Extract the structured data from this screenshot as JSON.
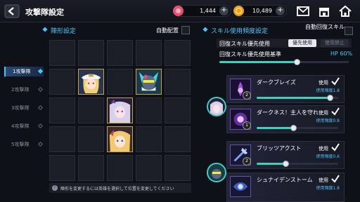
{
  "header": {
    "title": "攻撃隊設定",
    "currency1": "1,444",
    "currency2": "10,489",
    "plus": "+"
  },
  "left": {
    "section_title": "陣形設定",
    "auto_place": "自動配置",
    "tabs": [
      {
        "label": "1攻撃隊",
        "active": true
      },
      {
        "label": "2攻撃隊",
        "active": false
      },
      {
        "label": "3攻撃隊",
        "active": false
      },
      {
        "label": "4攻撃隊",
        "active": false
      },
      {
        "label": "5攻撃隊",
        "active": false
      }
    ],
    "hint_icon": "!",
    "hint": "陣形を変更するには英雄を選択して位置を変更してください"
  },
  "right": {
    "section_title": "スキル使用頻度設定",
    "auto_recovery": "自動回復スキル",
    "priority_label": "回復スキル優先使用",
    "priority_on": "優先使用",
    "priority_off": "使用禁止",
    "threshold_label": "回復スキル優先使用基準",
    "threshold_value": "HP 60%",
    "threshold_level": 0.6,
    "skills": [
      {
        "name": "ダークブレイズ",
        "use": "使用",
        "freq": "使用頻度1.8",
        "lvl": "2",
        "level": 0.9
      },
      {
        "name": "ダークネス！主人を守れ",
        "use": "使用",
        "freq": "使用頻度0.8",
        "lvl": "1",
        "level": 0.45
      },
      {
        "name": "ブリッツアクスト",
        "use": "使用",
        "freq": "使用頻度0.6",
        "lvl": "2",
        "level": 0.35
      },
      {
        "name": "シュナイデンストーム",
        "use": "使用",
        "freq": "使用頻度1.8",
        "lvl": "2",
        "level": 0.9
      }
    ]
  },
  "colors": {
    "accent": "#4fc3f7",
    "teal": "#3fd0c0",
    "gold": "#c9a24a",
    "bg": "#0f1118"
  }
}
